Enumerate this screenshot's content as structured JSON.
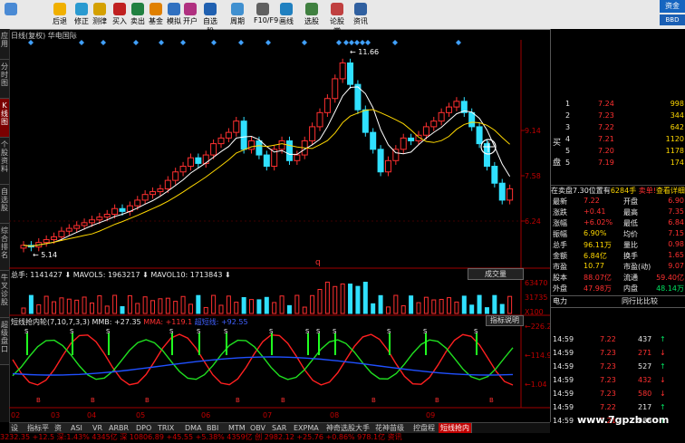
{
  "toolbar": {
    "buttons": [
      {
        "label": "",
        "icon": "nav-icon"
      },
      {
        "label": "后退",
        "icon": "back-icon"
      },
      {
        "label": "修正",
        "icon": "refresh-icon"
      },
      {
        "label": "测律",
        "icon": "lock-icon"
      },
      {
        "label": "买入",
        "icon": "buy-icon"
      },
      {
        "label": "卖出",
        "icon": "sell-icon"
      },
      {
        "label": "基金",
        "icon": "fund-icon"
      },
      {
        "label": "模拟",
        "icon": "sim-icon"
      },
      {
        "label": "开户",
        "icon": "account-icon"
      },
      {
        "label": "自选股",
        "icon": "star-icon"
      },
      {
        "label": "周期",
        "icon": "period-icon"
      },
      {
        "label": "F10/F9",
        "icon": "f10-icon"
      },
      {
        "label": "画线",
        "icon": "draw-icon"
      },
      {
        "label": "选股",
        "icon": "select-icon"
      },
      {
        "label": "论股堂",
        "icon": "forum-icon"
      },
      {
        "label": "资讯",
        "icon": "news-icon"
      }
    ],
    "brand_top": "资金",
    "brand_bottom": "BBD"
  },
  "side_tabs": [
    "应用",
    "分时图",
    "K线图",
    "个股资料",
    "自选股",
    "综合排名",
    "牛叉诊股",
    "超级盘口"
  ],
  "chart": {
    "title": "日线(复权) 华电国际",
    "high_label": "11.66",
    "low_label": "5.14",
    "q_marker": "q",
    "yaxis": [
      "9.14",
      "7.58",
      "6.24"
    ],
    "vol_title": {
      "label": "总手:",
      "value": "1141427",
      "mavol5_label": "MAVOL5:",
      "mavol5": "1963217",
      "mavol10_label": "MAVOL10:",
      "mavol10": "1713843"
    },
    "vol_axis": [
      "63470",
      "31735",
      "X100"
    ],
    "vol_button": "成交量",
    "ind_title": {
      "name": "短线抢内轮(7,10,7,3,3)",
      "mmb": "MMB: +27.35",
      "mma": "MMA: +119.1",
      "extra": "超短线: +92.55"
    },
    "ind_axis": [
      "226.2",
      "114.9",
      "1.04"
    ],
    "ind_button": "指标说明",
    "xaxis": [
      "02",
      "03",
      "04",
      "05",
      "06",
      "07",
      "08",
      "09"
    ],
    "close_series": [
      5.2,
      5.14,
      5.3,
      5.4,
      5.5,
      5.7,
      5.8,
      5.9,
      6.0,
      6.1,
      6.2,
      6.3,
      6.5,
      6.4,
      6.6,
      6.8,
      7.0,
      7.1,
      7.2,
      7.5,
      7.8,
      8.0,
      8.3,
      8.1,
      8.4,
      8.8,
      9.0,
      9.2,
      9.6,
      8.6,
      8.9,
      8.4,
      8.0,
      8.6,
      8.9,
      8.2,
      8.4,
      8.9,
      9.4,
      9.9,
      10.4,
      11.1,
      11.66,
      10.9,
      10.0,
      9.2,
      8.6,
      7.8,
      8.2,
      8.6,
      9.0,
      8.9,
      9.1,
      9.4,
      9.6,
      9.9,
      10.1,
      10.3,
      9.9,
      9.4,
      8.8,
      8.0,
      7.4,
      6.8,
      7.2
    ]
  },
  "quote": {
    "sell_rows": [
      {
        "n": "1",
        "price": "7.24",
        "vol": "998"
      },
      {
        "n": "2",
        "price": "7.23",
        "vol": "344"
      },
      {
        "n": "3",
        "price": "7.22",
        "vol": "642"
      },
      {
        "n": "4",
        "price": "7.21",
        "vol": "1120"
      },
      {
        "n": "5",
        "price": "7.20",
        "vol": "1178"
      },
      {
        "n": "5",
        "price": "7.19",
        "vol": "174"
      }
    ],
    "buy_label_1": "买",
    "buy_label_2": "盘",
    "status_line": {
      "text": "在卖盘7.30位置有",
      "qty": "6284手",
      "tag": "卖单!",
      "link": "查看详细"
    },
    "stats": [
      {
        "l": "最新",
        "v": "7.22",
        "l2": "开盘",
        "v2": "6.90"
      },
      {
        "l": "涨跌",
        "v": "+0.41",
        "l2": "最高",
        "v2": "7.35"
      },
      {
        "l": "涨幅",
        "v": "+6.02%",
        "l2": "最低",
        "v2": "6.84"
      },
      {
        "l": "振幅",
        "v": "6.90%",
        "l2": "均价",
        "v2": "7.15"
      },
      {
        "l": "总手",
        "v": "96.11万",
        "l2": "量比",
        "v2": "0.98"
      },
      {
        "l": "金额",
        "v": "6.84亿",
        "l2": "换手",
        "v2": "1.65"
      },
      {
        "l": "市盈",
        "v": "10.77",
        "l2": "市盈(动)",
        "v2": "9.07"
      },
      {
        "l": "股本",
        "v": "88.07亿",
        "l2": "流通",
        "v2": "59.40亿"
      },
      {
        "l": "外盘",
        "v": "47.98万",
        "l2": "内盘",
        "v2": "48.14万"
      }
    ],
    "sector_tabs": {
      "left": "电力",
      "right": "同行比比较"
    },
    "ticks": [
      {
        "t": "14:59",
        "p": "7.22",
        "v": "437",
        "d": "up"
      },
      {
        "t": "14:59",
        "p": "7.23",
        "v": "271",
        "d": "down"
      },
      {
        "t": "14:59",
        "p": "7.23",
        "v": "527",
        "d": "up"
      },
      {
        "t": "14:59",
        "p": "7.23",
        "v": "432",
        "d": "down"
      },
      {
        "t": "14:59",
        "p": "7.23",
        "v": "580",
        "d": "down"
      },
      {
        "t": "14:59",
        "p": "7.22",
        "v": "217",
        "d": "up"
      },
      {
        "t": "14:59",
        "p": "7.21",
        "v": "986",
        "d": "up"
      }
    ]
  },
  "bottom_tabs": [
    "设置",
    "指标平台",
    "资讯",
    "ASI",
    "VR",
    "ARBR",
    "DPO",
    "TRIX",
    "DMA",
    "BBI",
    "MTM",
    "OBV",
    "SAR",
    "EXPMA",
    "神奇选股大手筐线",
    "花神苗级市线",
    "控盘程度",
    "短线抢内轮"
  ],
  "active_tab": "短线抢内轮",
  "watermark": "www.7gpzb.com",
  "status_bar": "3232.35  +12.5  深:1.43%  4345亿  深 10806.89  +45.55  +5.38%  4359亿  创  2982.12  +25.76  +0.86%  978.1亿  资讯"
}
